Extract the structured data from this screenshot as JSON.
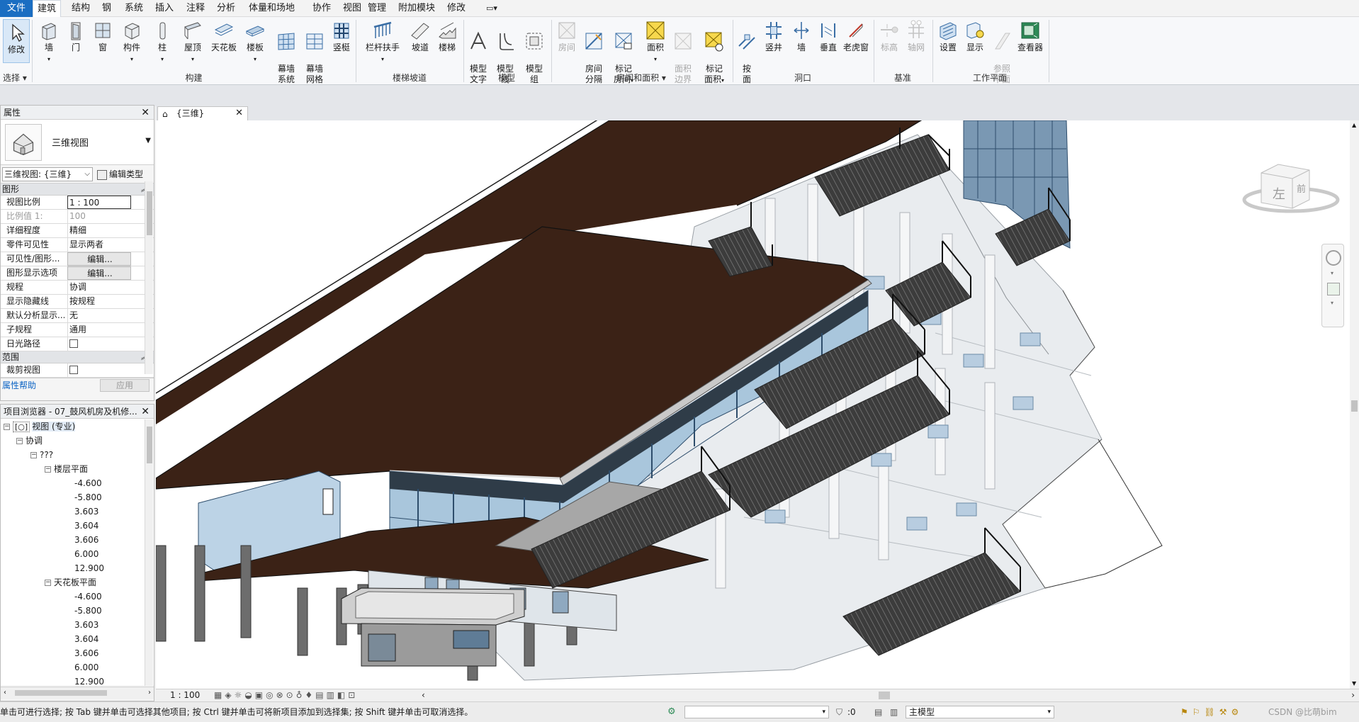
{
  "menubar": {
    "file": "文件",
    "tabs": [
      "建筑",
      "结构",
      "钢",
      "系统",
      "插入",
      "注释",
      "分析",
      "体量和场地",
      "协作",
      "视图",
      "管理",
      "附加模块",
      "修改"
    ]
  },
  "ribbon": {
    "modify": "修改",
    "select": "选择",
    "build": {
      "wall": "墙",
      "door": "门",
      "window": "窗",
      "component": "构件",
      "column": "柱",
      "roof": "屋顶",
      "ceiling": "天花板",
      "floor": "楼板",
      "curtain_system": "幕墙\n系统",
      "curtain_grid": "幕墙\n网格",
      "mullion": "竖梃",
      "group": "构建"
    },
    "stairs": {
      "railing": "栏杆扶手",
      "ramp": "坡道",
      "stair": "楼梯",
      "group": "楼梯坡道"
    },
    "model": {
      "text": "模型\n文字",
      "line": "模型\n线",
      "group_btn": "模型\n组",
      "group": "模型"
    },
    "room": {
      "room": "房间",
      "separator": "房间\n分隔",
      "tag_room": "标记\n房间",
      "area": "面积",
      "area_boundary": "面积\n边界",
      "tag_area": "标记\n面积",
      "group": "房间和面积"
    },
    "opening": {
      "by_face": "按\n面",
      "shaft": "竖井",
      "wall": "墙",
      "vertical": "垂直",
      "dormer": "老虎窗",
      "group": "洞口"
    },
    "datum": {
      "level": "标高",
      "grid": "轴网",
      "group": "基准"
    },
    "workplane": {
      "set": "设置",
      "show": "显示",
      "ref_plane": "参照\n平面",
      "viewer": "查看器",
      "group": "工作平面"
    }
  },
  "properties": {
    "title": "属性",
    "type_name": "三维视图",
    "selector": "三维视图: {三维}",
    "edit_type": "编辑类型",
    "section_graphics": "图形",
    "rows": [
      {
        "k": "视图比例",
        "v": "1 : 100"
      },
      {
        "k": "比例值 1:",
        "v": "100"
      },
      {
        "k": "详细程度",
        "v": "精细"
      },
      {
        "k": "零件可见性",
        "v": "显示两者"
      },
      {
        "k": "可见性/图形...",
        "v": "编辑..."
      },
      {
        "k": "图形显示选项",
        "v": "编辑..."
      },
      {
        "k": "规程",
        "v": "协调"
      },
      {
        "k": "显示隐藏线",
        "v": "按规程"
      },
      {
        "k": "默认分析显示...",
        "v": "无"
      },
      {
        "k": "子规程",
        "v": "通用"
      },
      {
        "k": "日光路径",
        "v": ""
      }
    ],
    "section_extents": "范围",
    "crop_label": "裁剪视图",
    "help": "属性帮助",
    "apply": "应用"
  },
  "browser": {
    "title": "项目浏览器 - 07_鼓风机房及机修...",
    "views": "视图 (专业)",
    "coord": "协调",
    "unknown": "???",
    "floor_plans": "楼层平面",
    "floor_levels": [
      "-4.600",
      "-5.800",
      "3.603",
      "3.604",
      "3.606",
      "6.000",
      "12.900"
    ],
    "ceiling_plans": "天花板平面",
    "ceiling_levels": [
      "-4.600",
      "-5.800",
      "3.603",
      "3.604",
      "3.606",
      "6.000",
      "12.900"
    ]
  },
  "view": {
    "tab": "{三维}",
    "scale": "1 : 100",
    "cube_left": "左",
    "cube_front": "前"
  },
  "status": {
    "message": "单击可进行选择; 按 Tab 键并单击可选择其他项目; 按 Ctrl 键并单击可将新项目添加到选择集; 按 Shift 键并单击可取消选择。",
    "zero": ":0",
    "model": "主模型",
    "watermark": "CSDN @比萌bim"
  }
}
